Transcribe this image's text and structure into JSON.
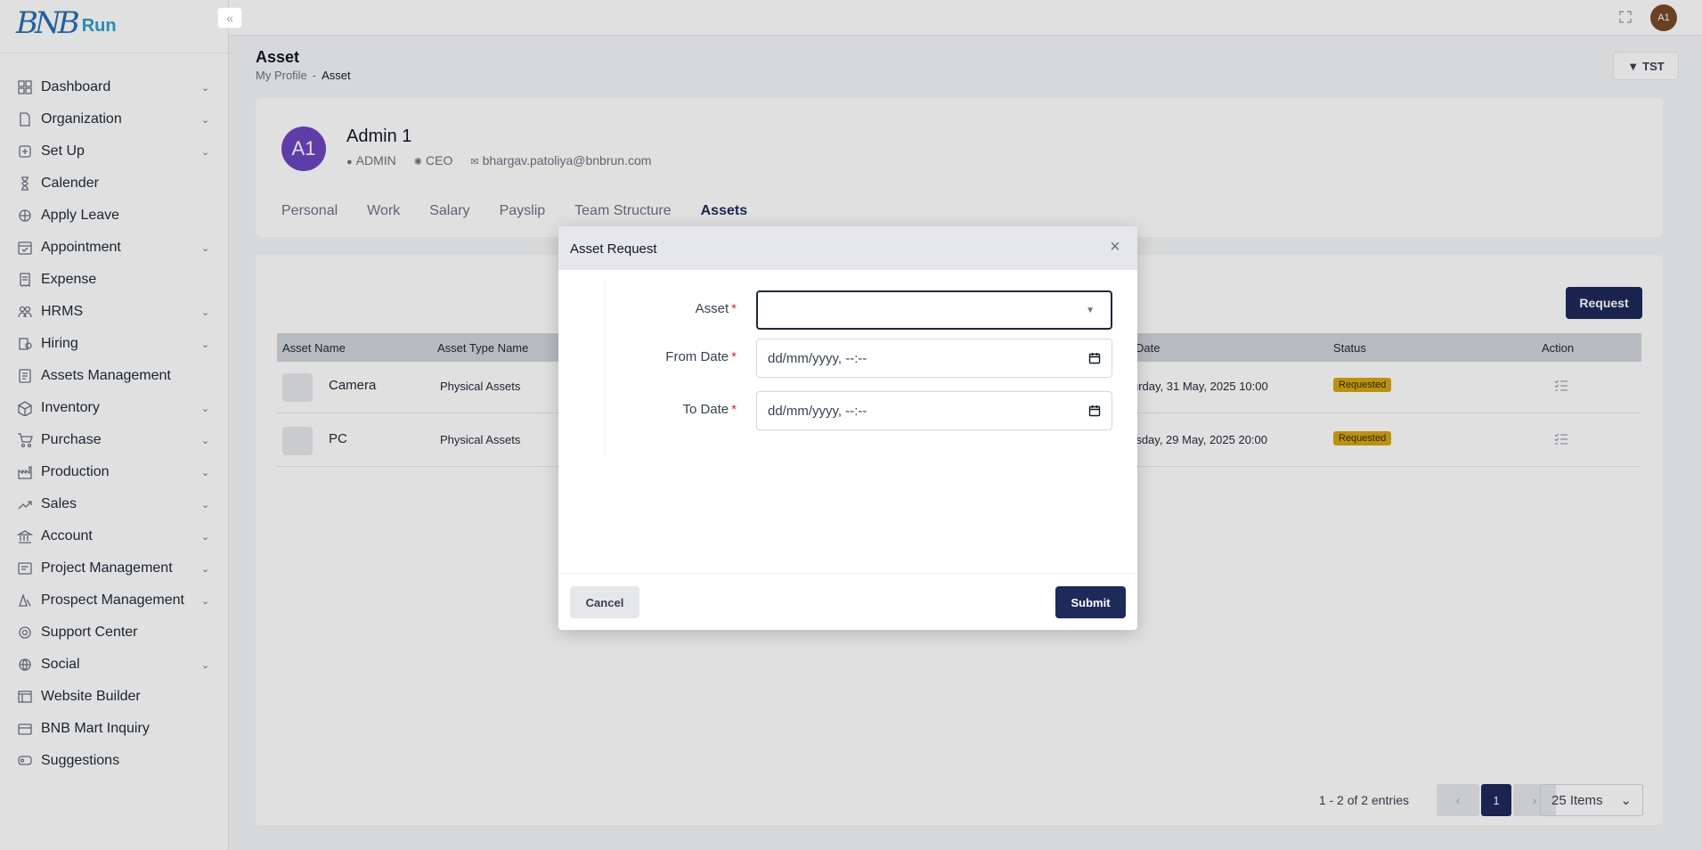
{
  "brand": {
    "logo_text": "BNB",
    "run_text": "Run"
  },
  "sidebar": {
    "items": [
      {
        "label": "Dashboard",
        "icon": "dashboard-icon",
        "has_children": true
      },
      {
        "label": "Organization",
        "icon": "document-icon",
        "has_children": true
      },
      {
        "label": "Set Up",
        "icon": "setup-icon",
        "has_children": true
      },
      {
        "label": "Calender",
        "icon": "hourglass-icon",
        "has_children": false
      },
      {
        "label": "Apply Leave",
        "icon": "leave-icon",
        "has_children": false
      },
      {
        "label": "Appointment",
        "icon": "calendar-check-icon",
        "has_children": true
      },
      {
        "label": "Expense",
        "icon": "receipt-icon",
        "has_children": false
      },
      {
        "label": "HRMS",
        "icon": "people-icon",
        "has_children": true
      },
      {
        "label": "Hiring",
        "icon": "hiring-icon",
        "has_children": true
      },
      {
        "label": "Assets Management",
        "icon": "assets-icon",
        "has_children": false
      },
      {
        "label": "Inventory",
        "icon": "inventory-icon",
        "has_children": true
      },
      {
        "label": "Purchase",
        "icon": "cart-icon",
        "has_children": true
      },
      {
        "label": "Production",
        "icon": "factory-icon",
        "has_children": true
      },
      {
        "label": "Sales",
        "icon": "sales-icon",
        "has_children": true
      },
      {
        "label": "Account",
        "icon": "bank-icon",
        "has_children": true
      },
      {
        "label": "Project Management",
        "icon": "project-icon",
        "has_children": true
      },
      {
        "label": "Prospect Management",
        "icon": "prospect-icon",
        "has_children": true
      },
      {
        "label": "Support Center",
        "icon": "support-icon",
        "has_children": false
      },
      {
        "label": "Social",
        "icon": "social-icon",
        "has_children": true
      },
      {
        "label": "Website Builder",
        "icon": "website-icon",
        "has_children": false
      },
      {
        "label": "BNB Mart Inquiry",
        "icon": "store-icon",
        "has_children": false
      },
      {
        "label": "Suggestions",
        "icon": "suggestion-icon",
        "has_children": false
      }
    ]
  },
  "topbar": {
    "avatar_initials": "A1"
  },
  "page": {
    "title": "Asset",
    "breadcrumb": {
      "parent": "My Profile",
      "separator": "-",
      "current": "Asset"
    },
    "filter_label": "TST"
  },
  "profile": {
    "initials": "A1",
    "name": "Admin 1",
    "role": "ADMIN",
    "designation": "CEO",
    "email": "bhargav.patoliya@bnbrun.com",
    "tabs": [
      "Personal",
      "Work",
      "Salary",
      "Payslip",
      "Team Structure",
      "Assets"
    ],
    "active_tab": "Assets"
  },
  "assets_table": {
    "request_label": "Request",
    "columns": [
      "Asset Name",
      "Asset Type Name",
      "Date",
      "Status",
      "Action"
    ],
    "rows": [
      {
        "name": "Camera",
        "type": "Physical Assets",
        "date": "urday, 31 May, 2025 10:00",
        "status": "Requested"
      },
      {
        "name": "PC",
        "type": "Physical Assets",
        "date": "rsday, 29 May, 2025 20:00",
        "status": "Requested"
      }
    ],
    "pager_info": "1 - 2 of 2 entries",
    "current_page": "1",
    "items_per_page": "25 Items"
  },
  "modal": {
    "title": "Asset Request",
    "fields": {
      "asset_label": "Asset",
      "asset_value": "",
      "from_label": "From Date",
      "from_placeholder": "dd/mm/yyyy, --:--",
      "to_label": "To Date",
      "to_placeholder": "dd/mm/yyyy, --:--",
      "required_mark": "*"
    },
    "cancel_label": "Cancel",
    "submit_label": "Submit"
  },
  "colors": {
    "primary": "#1e2a5a",
    "badge": "#d4a514",
    "avatar": "#6b46c1",
    "required": "#e11d48"
  }
}
